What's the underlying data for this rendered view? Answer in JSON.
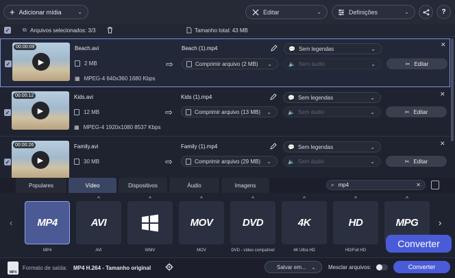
{
  "toolbar": {
    "add_media": "Adicionar mídia",
    "edit": "Editar",
    "settings": "Definições",
    "help": "?"
  },
  "selection": {
    "selected": "Arquivos selecionados: 3/3",
    "total": "Tamanho total: 43 MB"
  },
  "files": [
    {
      "duration": "00:00:09",
      "name": "Beach.avi",
      "size": "2 MB",
      "codec": "MPEG-4 640x360 1680 Kbps",
      "output": "Beach (1).mp4",
      "compress": "Comprimir arquivo (2 MB)",
      "subs": "Sem legendas",
      "audio": "Sem áudio",
      "edit": "Editar"
    },
    {
      "duration": "00:00:12",
      "name": "Kids.avi",
      "size": "12 MB",
      "codec": "MPEG-4 1920x1080 8537 Kbps",
      "output": "Kids (1).mp4",
      "compress": "Comprimir arquivo (13 MB)",
      "subs": "Sem legendas",
      "audio": "Sem áudio",
      "edit": "Editar"
    },
    {
      "duration": "00:00:26",
      "name": "Family.avi",
      "size": "30 MB",
      "codec": "",
      "output": "Family (1).mp4",
      "compress": "Comprimir arquivo (29 MB)",
      "subs": "Sem legendas",
      "audio": "Sem áudio",
      "edit": "Editar"
    }
  ],
  "tabs": [
    "Populares",
    "Vídeo",
    "Dispositivos",
    "Áudio",
    "Imagens"
  ],
  "search": {
    "value": "mp4"
  },
  "formats": [
    {
      "logo": "MP4",
      "label": "MP4"
    },
    {
      "logo": "AVI",
      "label": "AVI"
    },
    {
      "logo": "",
      "label": "WMV"
    },
    {
      "logo": "MOV",
      "label": "MOV"
    },
    {
      "logo": "DVD",
      "label": "DVD - vídeo compatível"
    },
    {
      "logo": "4K",
      "label": "4K Ultra HD"
    },
    {
      "logo": "HD",
      "label": "HD/Full HD"
    },
    {
      "logo": "MPG",
      "label": ""
    }
  ],
  "bottom": {
    "output_label": "Formato de saída:",
    "output_value": "MP4 H.264 - Tamanho original",
    "save": "Salvar em...",
    "merge": "Mesclar arquivos:",
    "convert": "Converter",
    "tooltip": "Converter"
  }
}
